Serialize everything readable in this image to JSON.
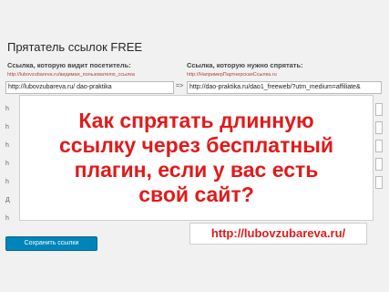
{
  "plugin": {
    "title": "Прятатель ссылок FREE",
    "left_column_label": "Ссылка, которую видит посетитель:",
    "right_column_label": "Ссылка, которую нужно спрятать:",
    "left_example": "http://lubovzubareva.ru/видимая_пользователю_ссылка",
    "right_example": "http://НапримерПартнерскаяСсылка.ru",
    "left_url_value": "http://lubovzubareva.ru/ dao-praktika",
    "right_url_value": "http://dao-praktika.ru/dao1_freeweb/?utm_medium=affiliate&",
    "arrow": "=>",
    "ghost_rows": [
      "h",
      "h",
      "h",
      "h",
      "h",
      "Д",
      "h"
    ],
    "save_button": "Сохранить ссылки"
  },
  "overlay": {
    "lines": [
      "Как спрятать длинную",
      "ссылку через бесплатный",
      "плагин, если у вас есть",
      "свой сайт?"
    ],
    "url": "http://lubovzubareva.ru/"
  },
  "colors": {
    "overlay_text": "#e11a1a",
    "button": "#0085ba",
    "example_text": "#a94442"
  }
}
